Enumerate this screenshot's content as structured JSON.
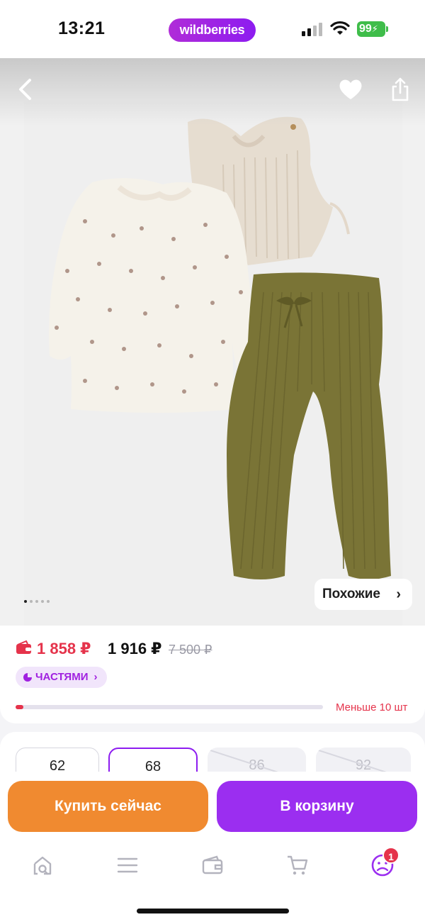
{
  "status_bar": {
    "time": "13:21",
    "brand": "wildberries",
    "battery": "99"
  },
  "gallery": {
    "page_count": 5,
    "current_page": 1,
    "similar_label": "Похожие",
    "similar_chevron": "›"
  },
  "price": {
    "wallet_price": "1 858 ₽",
    "price": "1 916 ₽",
    "old_price": "7 500 ₽",
    "installments_label": "ЧАСТЯМИ",
    "installments_chevron": "›",
    "stock_label": "Меньше 10 шт",
    "stock_fraction": 0.025
  },
  "sizes": [
    {
      "label": "62",
      "state": "available"
    },
    {
      "label": "68",
      "state": "selected"
    },
    {
      "label": "86",
      "state": "unavailable"
    },
    {
      "label": "92",
      "state": "unavailable"
    }
  ],
  "actions": {
    "buy_now": "Купить сейчас",
    "add_to_cart": "В корзину"
  },
  "tab_bar": {
    "items": [
      "home-search-icon",
      "menu-icon",
      "wallet-icon",
      "cart-icon",
      "profile-icon"
    ],
    "profile_badge": "1"
  },
  "colors": {
    "brand_purple": "#9b2ef0",
    "buy_orange": "#f08a30",
    "price_red": "#e5334b"
  }
}
